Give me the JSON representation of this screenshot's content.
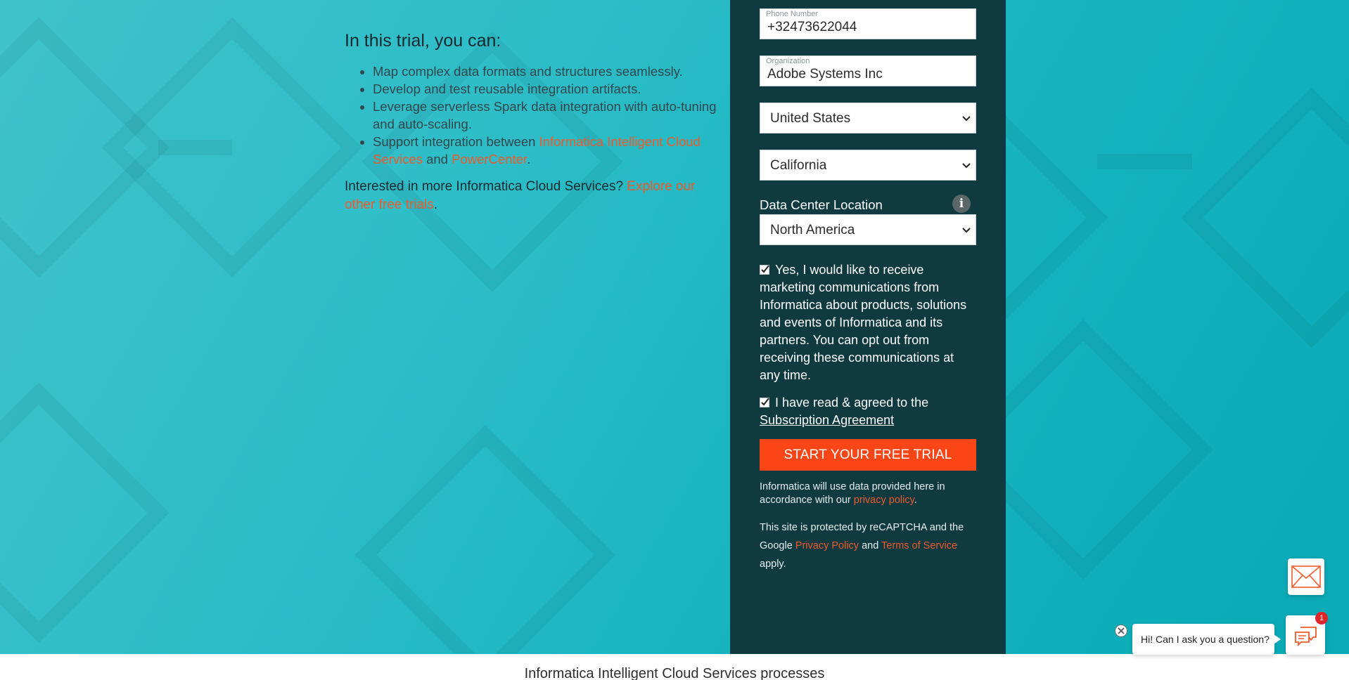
{
  "trial": {
    "heading": "In this trial, you can:",
    "bullets": {
      "b1": "Map complex data formats and structures seamlessly.",
      "b2": "Develop and test reusable integration artifacts.",
      "b3": "Leverage serverless Spark data integration with auto-tuning and auto-scaling.",
      "b4_prefix": "Support integration between ",
      "b4_link1": "Informatica Intelligent Cloud Services",
      "b4_and": " and ",
      "b4_link2": "PowerCenter",
      "b4_end": "."
    },
    "more_prefix": "Interested in more Informatica Cloud Services? ",
    "more_link": "Explore our other free trials",
    "more_end": "."
  },
  "form": {
    "phone": {
      "label": "Phone Number",
      "value": "+32473622044"
    },
    "organization": {
      "label": "Organization",
      "value": "Adobe Systems Inc"
    },
    "country": "United States",
    "state": "California",
    "data_center_label": "Data Center Location",
    "data_center_value": "North America",
    "info_icon": "i",
    "marketing_consent": "Yes, I would like to receive marketing communications from Informatica about products, solutions and events of Informatica and its partners. You can opt out from receiving these communications at any time.",
    "agreement_prefix": "I have read & agreed to the ",
    "agreement_link": "Subscription Agreement",
    "cta": "START YOUR FREE TRIAL",
    "privacy_prefix": "Informatica will use data provided here in accordance with our ",
    "privacy_link": "privacy policy",
    "privacy_end": ".",
    "recaptcha_prefix": "This site is protected by reCAPTCHA and the Google ",
    "recaptcha_privacy": "Privacy Policy",
    "recaptcha_and": " and ",
    "recaptcha_terms": "Terms of Service",
    "recaptcha_end": " apply."
  },
  "footer": {
    "text": "Informatica Intelligent Cloud Services processes"
  },
  "chat": {
    "greeting": "Hi! Can I ask you a question?",
    "badge_count": "1"
  },
  "colors": {
    "accent": "#fa4616",
    "link": "#f15a29",
    "panel": "#0e3a40",
    "hero": "#2cbdc8"
  }
}
